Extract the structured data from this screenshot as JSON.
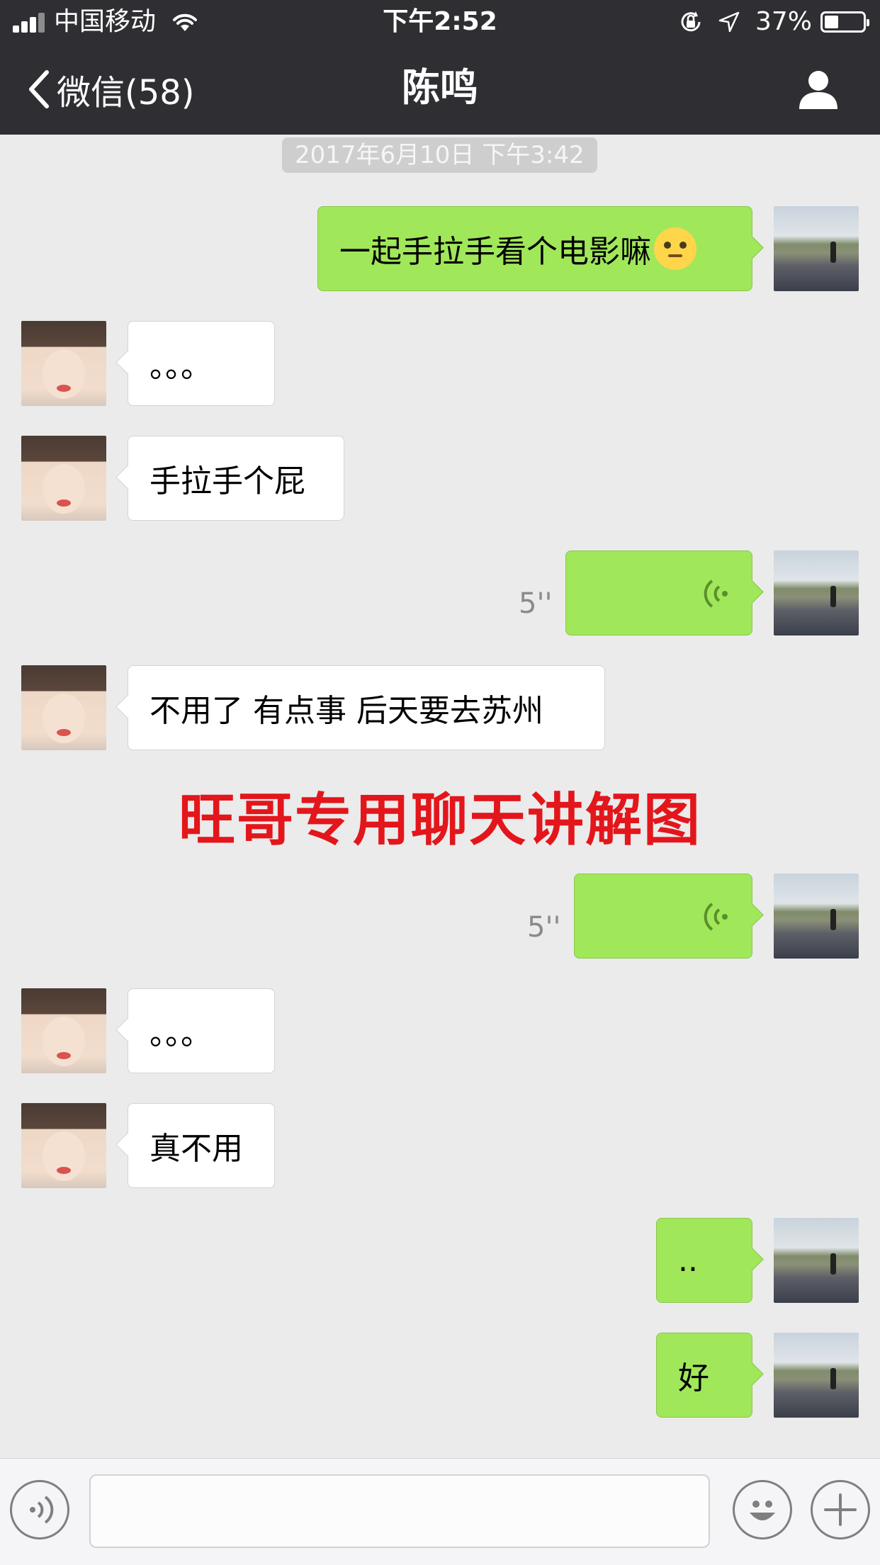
{
  "status_bar": {
    "carrier": "中国移动",
    "time": "下午2:52",
    "battery": "37%",
    "battery_level": 0.37
  },
  "nav": {
    "back_label": "微信(58)",
    "title": "陈鸣"
  },
  "messages": {
    "timestamp_1": "2017年6月10日 下午3:42",
    "m1_text": "一起手拉手看个电影嘛",
    "m2_text": "。。。",
    "m3_text": "手拉手个屁",
    "m4_duration": "5''",
    "m5_text": "不用了 有点事 后天要去苏州",
    "m6_duration": "5''",
    "m7_text": "。。。",
    "m8_text": "真不用",
    "m9_text": "..",
    "m10_text": "好"
  },
  "watermark": "旺哥专用聊天讲解图",
  "input_bar": {
    "value": ""
  },
  "colors": {
    "nav_bg": "#2f2f33",
    "chat_bg": "#ebebeb",
    "outgoing_bubble": "#a0e75a",
    "incoming_bubble": "#ffffff",
    "watermark": "#e3161b"
  },
  "icons": [
    "signal-icon",
    "wifi-icon",
    "rotation-lock-icon",
    "location-arrow-icon",
    "battery-icon",
    "chevron-left-icon",
    "person-icon",
    "voice-wave-icon",
    "voice-mode-icon",
    "emoji-icon",
    "plus-icon"
  ]
}
